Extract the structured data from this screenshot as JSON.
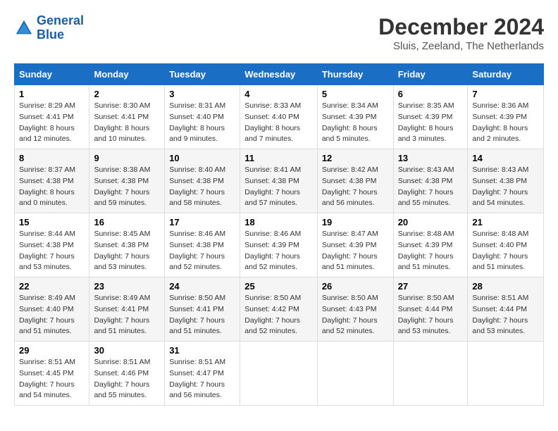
{
  "header": {
    "logo_line1": "General",
    "logo_line2": "Blue",
    "month_title": "December 2024",
    "location": "Sluis, Zeeland, The Netherlands"
  },
  "days_of_week": [
    "Sunday",
    "Monday",
    "Tuesday",
    "Wednesday",
    "Thursday",
    "Friday",
    "Saturday"
  ],
  "weeks": [
    [
      {
        "day": "1",
        "sunrise": "8:29 AM",
        "sunset": "4:41 PM",
        "daylight": "8 hours and 12 minutes."
      },
      {
        "day": "2",
        "sunrise": "8:30 AM",
        "sunset": "4:41 PM",
        "daylight": "8 hours and 10 minutes."
      },
      {
        "day": "3",
        "sunrise": "8:31 AM",
        "sunset": "4:40 PM",
        "daylight": "8 hours and 9 minutes."
      },
      {
        "day": "4",
        "sunrise": "8:33 AM",
        "sunset": "4:40 PM",
        "daylight": "8 hours and 7 minutes."
      },
      {
        "day": "5",
        "sunrise": "8:34 AM",
        "sunset": "4:39 PM",
        "daylight": "8 hours and 5 minutes."
      },
      {
        "day": "6",
        "sunrise": "8:35 AM",
        "sunset": "4:39 PM",
        "daylight": "8 hours and 3 minutes."
      },
      {
        "day": "7",
        "sunrise": "8:36 AM",
        "sunset": "4:39 PM",
        "daylight": "8 hours and 2 minutes."
      }
    ],
    [
      {
        "day": "8",
        "sunrise": "8:37 AM",
        "sunset": "4:38 PM",
        "daylight": "8 hours and 0 minutes."
      },
      {
        "day": "9",
        "sunrise": "8:38 AM",
        "sunset": "4:38 PM",
        "daylight": "7 hours and 59 minutes."
      },
      {
        "day": "10",
        "sunrise": "8:40 AM",
        "sunset": "4:38 PM",
        "daylight": "7 hours and 58 minutes."
      },
      {
        "day": "11",
        "sunrise": "8:41 AM",
        "sunset": "4:38 PM",
        "daylight": "7 hours and 57 minutes."
      },
      {
        "day": "12",
        "sunrise": "8:42 AM",
        "sunset": "4:38 PM",
        "daylight": "7 hours and 56 minutes."
      },
      {
        "day": "13",
        "sunrise": "8:43 AM",
        "sunset": "4:38 PM",
        "daylight": "7 hours and 55 minutes."
      },
      {
        "day": "14",
        "sunrise": "8:43 AM",
        "sunset": "4:38 PM",
        "daylight": "7 hours and 54 minutes."
      }
    ],
    [
      {
        "day": "15",
        "sunrise": "8:44 AM",
        "sunset": "4:38 PM",
        "daylight": "7 hours and 53 minutes."
      },
      {
        "day": "16",
        "sunrise": "8:45 AM",
        "sunset": "4:38 PM",
        "daylight": "7 hours and 53 minutes."
      },
      {
        "day": "17",
        "sunrise": "8:46 AM",
        "sunset": "4:38 PM",
        "daylight": "7 hours and 52 minutes."
      },
      {
        "day": "18",
        "sunrise": "8:46 AM",
        "sunset": "4:39 PM",
        "daylight": "7 hours and 52 minutes."
      },
      {
        "day": "19",
        "sunrise": "8:47 AM",
        "sunset": "4:39 PM",
        "daylight": "7 hours and 51 minutes."
      },
      {
        "day": "20",
        "sunrise": "8:48 AM",
        "sunset": "4:39 PM",
        "daylight": "7 hours and 51 minutes."
      },
      {
        "day": "21",
        "sunrise": "8:48 AM",
        "sunset": "4:40 PM",
        "daylight": "7 hours and 51 minutes."
      }
    ],
    [
      {
        "day": "22",
        "sunrise": "8:49 AM",
        "sunset": "4:40 PM",
        "daylight": "7 hours and 51 minutes."
      },
      {
        "day": "23",
        "sunrise": "8:49 AM",
        "sunset": "4:41 PM",
        "daylight": "7 hours and 51 minutes."
      },
      {
        "day": "24",
        "sunrise": "8:50 AM",
        "sunset": "4:41 PM",
        "daylight": "7 hours and 51 minutes."
      },
      {
        "day": "25",
        "sunrise": "8:50 AM",
        "sunset": "4:42 PM",
        "daylight": "7 hours and 52 minutes."
      },
      {
        "day": "26",
        "sunrise": "8:50 AM",
        "sunset": "4:43 PM",
        "daylight": "7 hours and 52 minutes."
      },
      {
        "day": "27",
        "sunrise": "8:50 AM",
        "sunset": "4:44 PM",
        "daylight": "7 hours and 53 minutes."
      },
      {
        "day": "28",
        "sunrise": "8:51 AM",
        "sunset": "4:44 PM",
        "daylight": "7 hours and 53 minutes."
      }
    ],
    [
      {
        "day": "29",
        "sunrise": "8:51 AM",
        "sunset": "4:45 PM",
        "daylight": "7 hours and 54 minutes."
      },
      {
        "day": "30",
        "sunrise": "8:51 AM",
        "sunset": "4:46 PM",
        "daylight": "7 hours and 55 minutes."
      },
      {
        "day": "31",
        "sunrise": "8:51 AM",
        "sunset": "4:47 PM",
        "daylight": "7 hours and 56 minutes."
      },
      null,
      null,
      null,
      null
    ]
  ]
}
